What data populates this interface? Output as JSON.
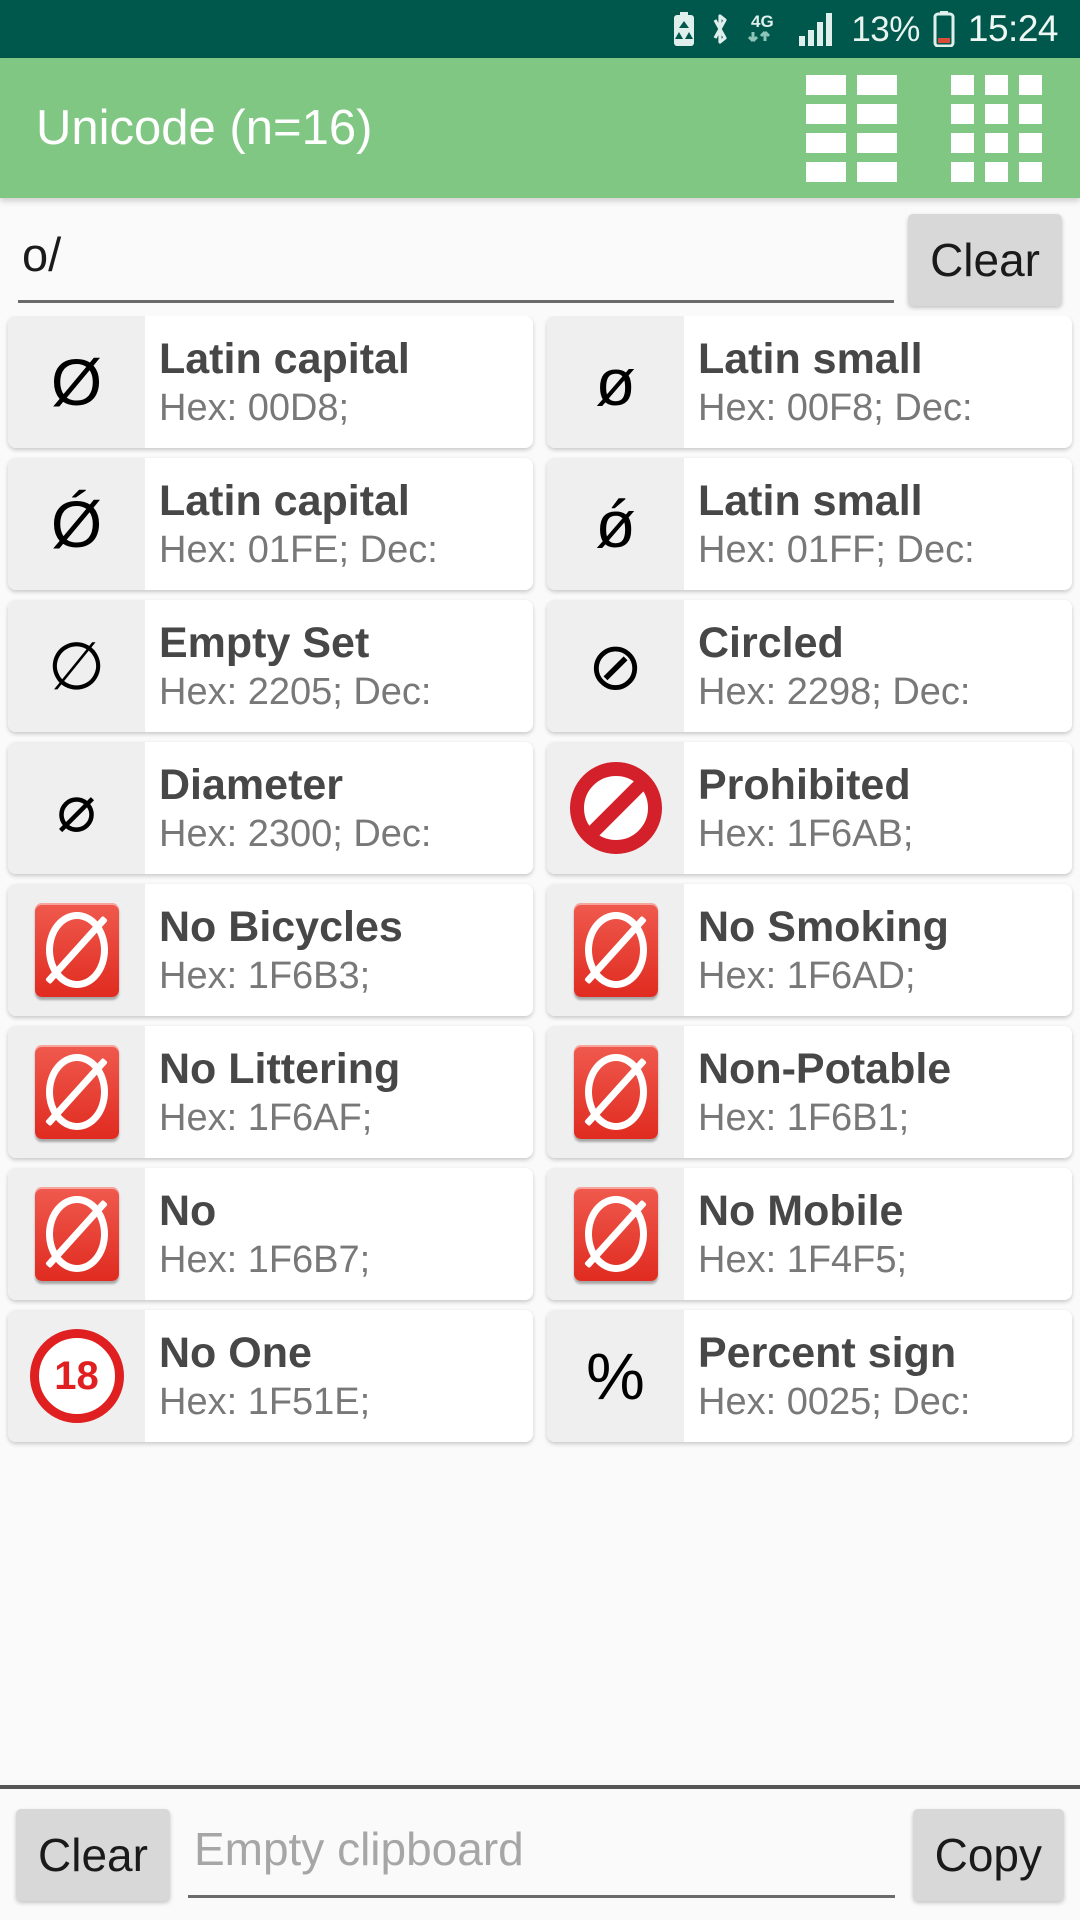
{
  "status_bar": {
    "battery_saver_icon": "battery-saver-icon",
    "bluetooth_icon": "bluetooth-icon",
    "network_label": "4G",
    "signal_icon": "signal-bars-icon",
    "battery_percent": "13%",
    "battery_icon": "battery-icon",
    "time": "15:24",
    "background_color": "#00574B"
  },
  "app_bar": {
    "title": "Unicode (n=16)",
    "background_color": "#81C784",
    "actions": [
      {
        "name": "two-column-grid-view",
        "icon": "grid-2col-icon"
      },
      {
        "name": "three-column-grid-view",
        "icon": "grid-3col-icon"
      }
    ]
  },
  "search": {
    "value": "o/",
    "placeholder": "",
    "clear_label": "Clear"
  },
  "results": {
    "cards": [
      {
        "glyph": "Ø",
        "kind": "text",
        "title": "Latin capital",
        "sub": "Hex: 00D8;"
      },
      {
        "glyph": "ø",
        "kind": "text",
        "title": "Latin small",
        "sub": "Hex: 00F8; Dec:"
      },
      {
        "glyph": "Ǿ",
        "kind": "text",
        "title": "Latin capital",
        "sub": "Hex: 01FE; Dec:"
      },
      {
        "glyph": "ǿ",
        "kind": "text",
        "title": "Latin small",
        "sub": "Hex: 01FF; Dec:"
      },
      {
        "glyph": "∅",
        "kind": "text",
        "title": "Empty Set",
        "sub": "Hex: 2205; Dec:"
      },
      {
        "glyph": "⊘",
        "kind": "text",
        "title": "Circled",
        "sub": "Hex: 2298; Dec:"
      },
      {
        "glyph": "⌀",
        "kind": "text",
        "title": "Diameter",
        "sub": "Hex: 2300; Dec:"
      },
      {
        "glyph": "🚫",
        "kind": "prohibited",
        "title": "Prohibited",
        "sub": "Hex: 1F6AB;"
      },
      {
        "glyph": "🚳",
        "kind": "emoji-bike",
        "title": "No Bicycles",
        "sub": "Hex: 1F6B3;"
      },
      {
        "glyph": "🚭",
        "kind": "emoji-smoke",
        "title": "No Smoking",
        "sub": "Hex: 1F6AD;"
      },
      {
        "glyph": "🚯",
        "kind": "emoji-litter",
        "title": "No Littering",
        "sub": "Hex: 1F6AF;"
      },
      {
        "glyph": "🚱",
        "kind": "emoji-water",
        "title": "Non-Potable",
        "sub": "Hex: 1F6B1;"
      },
      {
        "glyph": "🚷",
        "kind": "emoji-ped",
        "title": "No",
        "sub": "Hex: 1F6B7;"
      },
      {
        "glyph": "📵",
        "kind": "emoji-mobile",
        "title": "No Mobile",
        "sub": "Hex: 1F4F5;"
      },
      {
        "glyph": "🔞",
        "kind": "noone",
        "title": "No One",
        "sub": "Hex: 1F51E;"
      },
      {
        "glyph": "%",
        "kind": "text",
        "title": "Percent sign",
        "sub": "Hex: 0025; Dec:"
      }
    ]
  },
  "bottom_bar": {
    "clear_label": "Clear",
    "clipboard_placeholder": "Empty clipboard",
    "clipboard_value": "",
    "copy_label": "Copy"
  }
}
